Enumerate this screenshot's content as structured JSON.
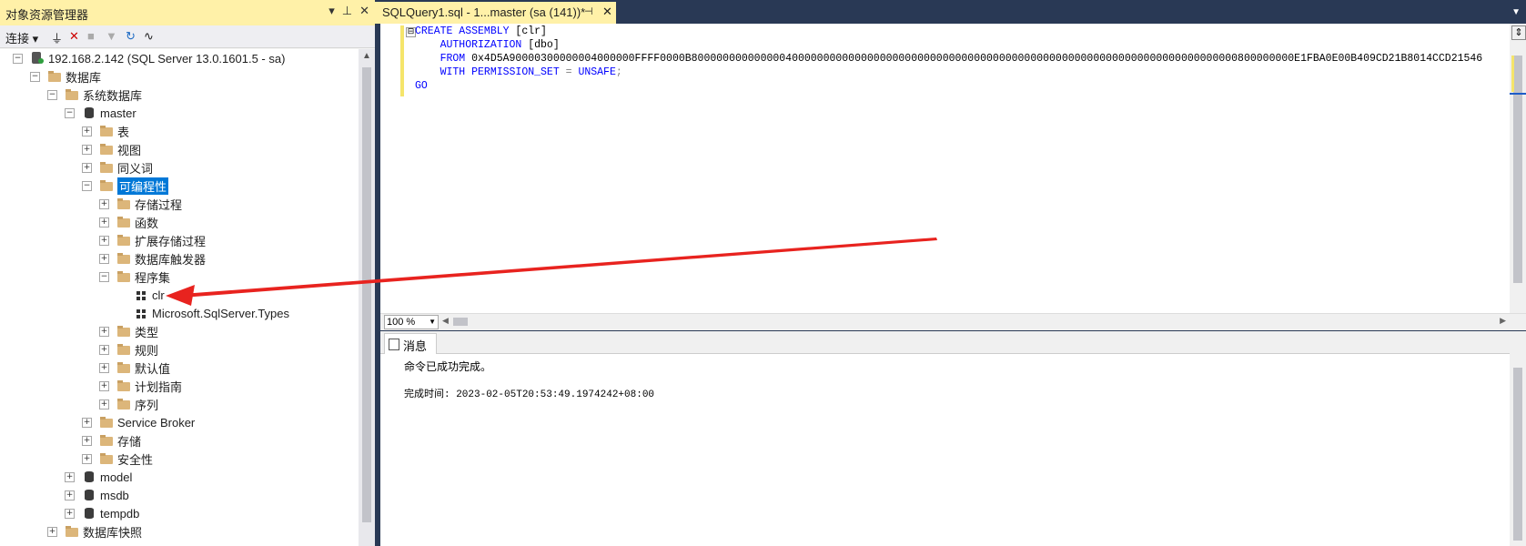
{
  "object_explorer": {
    "title": "对象资源管理器",
    "title_buttons": [
      "▾",
      "⊥",
      "✕"
    ],
    "toolbar": {
      "connect_label": "连接 ▾",
      "icons": [
        "connect-icon",
        "disconnect-icon",
        "stop-icon",
        "filter-icon",
        "refresh-icon",
        "activity-monitor-icon"
      ]
    },
    "tree": [
      {
        "label": "192.168.2.142 (SQL Server 13.0.1601.5 - sa)",
        "level": 0,
        "expander": "⊟",
        "icon": "server"
      },
      {
        "label": "数据库",
        "level": 1,
        "expander": "⊟",
        "icon": "folder"
      },
      {
        "label": "系统数据库",
        "level": 2,
        "expander": "⊟",
        "icon": "folder"
      },
      {
        "label": "master",
        "level": 3,
        "expander": "⊟",
        "icon": "db"
      },
      {
        "label": "表",
        "level": 4,
        "expander": "⊞",
        "icon": "folder"
      },
      {
        "label": "视图",
        "level": 4,
        "expander": "⊞",
        "icon": "folder"
      },
      {
        "label": "同义词",
        "level": 4,
        "expander": "⊞",
        "icon": "folder"
      },
      {
        "label": "可编程性",
        "level": 4,
        "expander": "⊟",
        "icon": "folder",
        "selected": true
      },
      {
        "label": "存储过程",
        "level": 5,
        "expander": "⊞",
        "icon": "folder"
      },
      {
        "label": "函数",
        "level": 5,
        "expander": "⊞",
        "icon": "folder"
      },
      {
        "label": "扩展存储过程",
        "level": 5,
        "expander": "⊞",
        "icon": "folder"
      },
      {
        "label": "数据库触发器",
        "level": 5,
        "expander": "⊞",
        "icon": "folder"
      },
      {
        "label": "程序集",
        "level": 5,
        "expander": "⊟",
        "icon": "folder"
      },
      {
        "label": "clr",
        "level": 6,
        "expander": "",
        "icon": "asm"
      },
      {
        "label": "Microsoft.SqlServer.Types",
        "level": 6,
        "expander": "",
        "icon": "asm"
      },
      {
        "label": "类型",
        "level": 5,
        "expander": "⊞",
        "icon": "folder"
      },
      {
        "label": "规则",
        "level": 5,
        "expander": "⊞",
        "icon": "folder"
      },
      {
        "label": "默认值",
        "level": 5,
        "expander": "⊞",
        "icon": "folder"
      },
      {
        "label": "计划指南",
        "level": 5,
        "expander": "⊞",
        "icon": "folder"
      },
      {
        "label": "序列",
        "level": 5,
        "expander": "⊞",
        "icon": "folder"
      },
      {
        "label": "Service Broker",
        "level": 4,
        "expander": "⊞",
        "icon": "folder"
      },
      {
        "label": "存储",
        "level": 4,
        "expander": "⊞",
        "icon": "folder"
      },
      {
        "label": "安全性",
        "level": 4,
        "expander": "⊞",
        "icon": "folder"
      },
      {
        "label": "model",
        "level": 3,
        "expander": "⊞",
        "icon": "db"
      },
      {
        "label": "msdb",
        "level": 3,
        "expander": "⊞",
        "icon": "db"
      },
      {
        "label": "tempdb",
        "level": 3,
        "expander": "⊞",
        "icon": "db"
      },
      {
        "label": "数据库快照",
        "level": 2,
        "expander": "⊞",
        "icon": "folder"
      }
    ]
  },
  "tab": {
    "title": "SQLQuery1.sql - 1...master (sa (141))*",
    "pin": "⊣",
    "close": "✕"
  },
  "editor": {
    "lines": [
      {
        "kw1": "CREATE ASSEMBLY",
        "rest": " [clr]"
      },
      {
        "kw1": "    AUTHORIZATION",
        "rest": " [dbo]"
      },
      {
        "kw1": "    FROM",
        "rest": " 0x4D5A90000300000004000000FFFF0000B800000000000000400000000000000000000000000000000000000000000000000000000000000000000000800000000E1FBA0E00B409CD21B8014CCD21546"
      },
      {
        "kw1": "    WITH PERMISSION_SET",
        "rest": " = ",
        "kw2": "UNSAFE",
        "tail": ";"
      },
      {
        "kw1": "GO",
        "rest": ""
      }
    ],
    "collapse_glyph": "⊟"
  },
  "zoom": "100 %",
  "results": {
    "tab_label": "消息",
    "message": "命令已成功完成。",
    "completion": "完成时间: 2023-02-05T20:53:49.1974242+08:00"
  },
  "colors": {
    "arrow": "#e8231f",
    "selection": "#0078d7",
    "tab_active": "#fff1a8"
  }
}
